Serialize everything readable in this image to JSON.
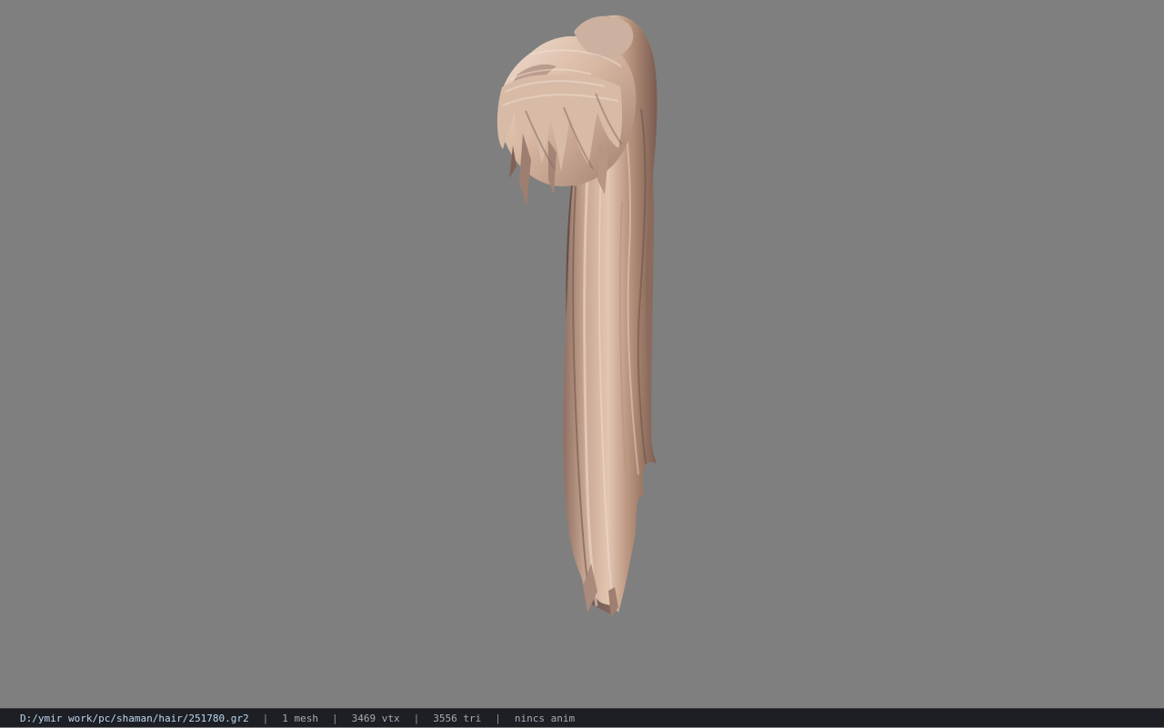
{
  "viewport": {
    "background": "#7f7f7f",
    "model": "hair-model"
  },
  "statusbar": {
    "file_path": "D:/ymir work/pc/shaman/hair/251780.gr2",
    "separator": "|",
    "mesh_count": "1 mesh",
    "vertex_count": "3469 vtx",
    "triangle_count": "3556 tri",
    "animation_status": "nincs anim"
  }
}
